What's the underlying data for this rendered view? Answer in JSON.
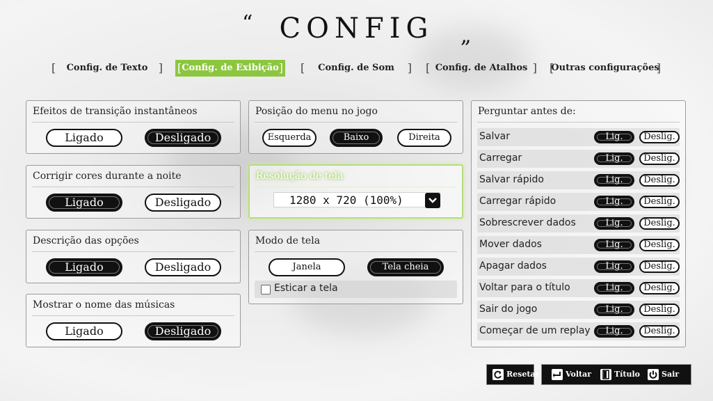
{
  "title": "CONFIG",
  "quote_open": "“",
  "quote_close": "„",
  "tabs": [
    {
      "label": "Config. de Texto"
    },
    {
      "label": "Config. de Exibição"
    },
    {
      "label": "Config. de Som"
    },
    {
      "label": "Config. de Atalhos"
    },
    {
      "label": "Outras configurações"
    }
  ],
  "bracket_open": "[",
  "bracket_close": "]",
  "colors": {
    "accent": "#8cc63f",
    "on": "#111111",
    "off": "#ffffff"
  },
  "left_panels": [
    {
      "title": "Efeitos de transição instantâneos",
      "on_label": "Ligado",
      "off_label": "Desligado",
      "selected": "off"
    },
    {
      "title": "Corrigir cores durante a noite",
      "on_label": "Ligado",
      "off_label": "Desligado",
      "selected": "on"
    },
    {
      "title": "Descrição das opções",
      "on_label": "Ligado",
      "off_label": "Desligado",
      "selected": "on"
    },
    {
      "title": "Mostrar o nome das músicas",
      "on_label": "Ligado",
      "off_label": "Desligado",
      "selected": "off"
    }
  ],
  "menu_position": {
    "title": "Posição do menu no jogo",
    "options": [
      "Esquerda",
      "Baixo",
      "Direita"
    ],
    "selected": "Baixo"
  },
  "resolution": {
    "title": "Resolução de tela",
    "value": "1280 x 720  (100%)",
    "dropdown_icon": "chevron-down-icon"
  },
  "screen_mode": {
    "title": "Modo de tela",
    "options": [
      "Janela",
      "Tela cheia"
    ],
    "selected": "Tela cheia",
    "stretch_label": "Esticar a tela",
    "stretch_checked": false
  },
  "ask_before": {
    "title": "Perguntar antes de:",
    "on_label": "Lig.",
    "off_label": "Deslig.",
    "items": [
      {
        "label": "Salvar",
        "selected": "on"
      },
      {
        "label": "Carregar",
        "selected": "on"
      },
      {
        "label": "Salvar rápido",
        "selected": "on"
      },
      {
        "label": "Carregar rápido",
        "selected": "on"
      },
      {
        "label": "Sobrescrever dados",
        "selected": "on"
      },
      {
        "label": "Mover dados",
        "selected": "on"
      },
      {
        "label": "Apagar dados",
        "selected": "on"
      },
      {
        "label": "Voltar para o título",
        "selected": "on"
      },
      {
        "label": "Sair do jogo",
        "selected": "on"
      },
      {
        "label": "Começar de um replay",
        "selected": "on"
      }
    ]
  },
  "bottom": {
    "reset": "Resetar",
    "back": "Voltar",
    "title_screen": "Título",
    "exit": "Sair"
  }
}
